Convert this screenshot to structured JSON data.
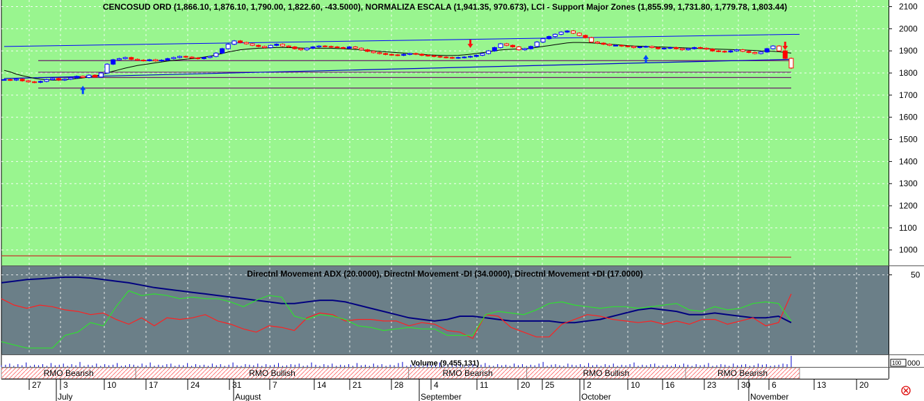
{
  "colors": {
    "price_bg": "#99f58f",
    "adx_bg": "#6b7f88",
    "bull_candle": "#0000ff",
    "bear_candle": "#ff0000",
    "adx_line": "#00007f",
    "minus_di_line": "#ff2020",
    "plus_di_line": "#30e030",
    "volume_bar": "#0000cc",
    "grid": "#ffffff",
    "rmo_hatch": "#ff6060"
  },
  "price_panel": {
    "title": "CENCOSUD ORD (1,866.10, 1,876.10, 1,790.00, 1,822.60, -43.5000), NORMALIZA ESCALA (1,941.35, 970.673), LCI - Support Major Zones (1,855.99, 1,731.80, 1,779.78, 1,803.44)",
    "y_ticks": [
      "2100",
      "2000",
      "1900",
      "1800",
      "1700",
      "1600",
      "1500",
      "1400",
      "1300",
      "1200",
      "1100",
      "1000"
    ]
  },
  "adx_panel": {
    "title": "Directnl Movement ADX (20.0000), Directnl Movement -DI (34.0000), Directnl Movement +DI (17.0000)",
    "y_ticks": [
      "50"
    ]
  },
  "volume_panel": {
    "title": "Volume (9,455,131)",
    "axis_box": "100",
    "axis_label": "000"
  },
  "rmo_bands": [
    {
      "label": "RMO Bearish",
      "start": 0,
      "end": 33
    },
    {
      "label": "RMO Bullish",
      "start": 33,
      "end": 100
    },
    {
      "label": "RMO Bearish",
      "start": 100,
      "end": 129
    },
    {
      "label": "RMO Bullish",
      "start": 129,
      "end": 168
    },
    {
      "label": "RMO Bearish",
      "start": 168,
      "end": 196
    }
  ],
  "x_axis": {
    "day_labels": [
      "27",
      "3",
      "10",
      "17",
      "24",
      "31",
      "7",
      "14",
      "21",
      "28",
      "4",
      "11",
      "20",
      "25",
      "2",
      "10",
      "16",
      "23",
      "30",
      "6",
      "13",
      "20"
    ],
    "month_labels": [
      "July",
      "August",
      "September",
      "October",
      "November"
    ]
  },
  "chart_data": [
    {
      "type": "candlestick",
      "title": "CENCOSUD ORD (1,866.10, 1,876.10, 1,790.00, 1,822.60, -43.5000), NORMALIZA ESCALA (1,941.35, 970.673), LCI - Support Major Zones (1,855.99, 1,731.80, 1,779.78, 1,803.44)",
      "ylim": [
        930,
        2130
      ],
      "last_bar": {
        "open": 1866.1,
        "high": 1876.1,
        "low": 1790.0,
        "close": 1822.6,
        "change": -43.5
      },
      "series": [
        {
          "kind": "close",
          "values": [
            1770,
            1768,
            1772,
            1765,
            1760,
            1758,
            1762,
            1770,
            1775,
            1768,
            1772,
            1778,
            1785,
            1780,
            1790,
            1782,
            1800,
            1840,
            1860,
            1865,
            1870,
            1862,
            1858,
            1856,
            1860,
            1855,
            1858,
            1865,
            1870,
            1875,
            1872,
            1868,
            1865,
            1870,
            1875,
            1890,
            1910,
            1930,
            1945,
            1938,
            1932,
            1925,
            1920,
            1915,
            1925,
            1930,
            1922,
            1918,
            1910,
            1905,
            1912,
            1918,
            1922,
            1920,
            1918,
            1915,
            1912,
            1918,
            1912,
            1905,
            1898,
            1892,
            1888,
            1884,
            1882,
            1880,
            1884,
            1888,
            1885,
            1880,
            1878,
            1875,
            1872,
            1870,
            1868,
            1870,
            1872,
            1875,
            1880,
            1888,
            1900,
            1915,
            1932,
            1925,
            1918,
            1905,
            1910,
            1920,
            1940,
            1955,
            1965,
            1975,
            1985,
            1990,
            1980,
            1970,
            1960,
            1940,
            1935,
            1930,
            1925,
            1925,
            1922,
            1920,
            1915,
            1918,
            1920,
            1915,
            1910,
            1912,
            1915,
            1910,
            1905,
            1910,
            1915,
            1912,
            1908,
            1900,
            1898,
            1895,
            1900,
            1905,
            1898,
            1893,
            1888,
            1895,
            1910,
            1922,
            1900,
            1866,
            1822.6
          ]
        },
        {
          "kind": "ma_black",
          "values": [
            1812,
            1805,
            1795,
            1788,
            1782,
            1776,
            1772,
            1770,
            1768,
            1768,
            1770,
            1772,
            1775,
            1778,
            1782,
            1786,
            1792,
            1800,
            1808,
            1815,
            1822,
            1828,
            1834,
            1838,
            1842,
            1846,
            1850,
            1854,
            1857,
            1860,
            1862,
            1865,
            1868,
            1872,
            1876,
            1882,
            1888,
            1895,
            1900,
            1905,
            1908,
            1910,
            1912,
            1913,
            1914,
            1915,
            1915,
            1915,
            1914,
            1913,
            1912,
            1912,
            1912,
            1912,
            1912,
            1911,
            1910,
            1908,
            1906,
            1904,
            1902,
            1900,
            1898,
            1896,
            1894,
            1892,
            1890,
            1888,
            1886,
            1884,
            1882,
            1881,
            1880,
            1879,
            1879,
            1880,
            1882,
            1885,
            1888,
            1892,
            1896,
            1900,
            1904,
            1906,
            1908,
            1909,
            1910,
            1912,
            1916,
            1920,
            1924,
            1928,
            1932,
            1936,
            1938,
            1938,
            1937,
            1936,
            1934,
            1932,
            1930,
            1928,
            1926,
            1924,
            1922,
            1921,
            1920,
            1919,
            1918,
            1917,
            1916,
            1915,
            1914,
            1913,
            1912,
            1911,
            1910,
            1909,
            1908,
            1907,
            1906,
            1905,
            1904,
            1903,
            1902,
            1900,
            1899,
            1898,
            1896,
            1893,
            1890
          ]
        },
        {
          "kind": "support_zone",
          "levels": [
            1855.99,
            1731.8,
            1779.78,
            1803.44
          ]
        },
        {
          "kind": "channel_top",
          "x": [
            0,
            195
          ],
          "values": [
            1920,
            1975
          ]
        },
        {
          "kind": "trend_line",
          "x": [
            0,
            130
          ],
          "values": [
            1775,
            1862
          ]
        },
        {
          "kind": "normaliza_escala",
          "value": 970.673
        }
      ],
      "signals": [
        {
          "x": 13,
          "dir": "up"
        },
        {
          "x": 77,
          "dir": "down"
        },
        {
          "x": 106,
          "dir": "up"
        },
        {
          "x": 129,
          "dir": "down"
        }
      ]
    },
    {
      "type": "line",
      "title": "Directnl Movement ADX (20.0000), Directnl Movement -DI (34.0000), Directnl Movement +DI (17.0000)",
      "ylim": [
        0,
        55
      ],
      "series": [
        {
          "name": "Directnl Movement ADX",
          "values": [
            45,
            46,
            47,
            47.5,
            48,
            48.5,
            48.5,
            48,
            47,
            46,
            45,
            43.5,
            42,
            41,
            40,
            39,
            38,
            37,
            36,
            35,
            34,
            33,
            32,
            32,
            33,
            34,
            34,
            33,
            31,
            29,
            27,
            25,
            23,
            22,
            21,
            22,
            24,
            24,
            23,
            22,
            21,
            21,
            21,
            21,
            20,
            20,
            21,
            22,
            24,
            26,
            28,
            29,
            28,
            27,
            25,
            25,
            26,
            25,
            24,
            23,
            23,
            24,
            20
          ]
        },
        {
          "name": "Directnl Movement -DI",
          "values": [
            35,
            31,
            29,
            31,
            30,
            28,
            27,
            25,
            26,
            22,
            19,
            23,
            18,
            23,
            22,
            23,
            25,
            21,
            19,
            16,
            14,
            18,
            17,
            15,
            23,
            26,
            25,
            21,
            22,
            22,
            21,
            21,
            18,
            20,
            19,
            15,
            14,
            10,
            25,
            24,
            17,
            14,
            11,
            11,
            19,
            22,
            25,
            24,
            22,
            21,
            20,
            21,
            19,
            21,
            19,
            22,
            22,
            19,
            21,
            23,
            18,
            20,
            38
          ]
        },
        {
          "name": "Directnl Movement +DI",
          "values": [
            8,
            6,
            4,
            4,
            4,
            12,
            14,
            20,
            18,
            30,
            40,
            37,
            38,
            37,
            35,
            36,
            35,
            35,
            33,
            30,
            34,
            37,
            36,
            24,
            22,
            25,
            24,
            22,
            18,
            17,
            15,
            16,
            17,
            16,
            16,
            12,
            12,
            12,
            25,
            27,
            26,
            25,
            28,
            32,
            33,
            31,
            30,
            29,
            30,
            30,
            29,
            30,
            31,
            32,
            28,
            27,
            30,
            28,
            29,
            32,
            33,
            32,
            21
          ]
        }
      ]
    },
    {
      "type": "bar",
      "title": "Volume (9,455,131)",
      "series": [
        {
          "name": "Volume",
          "values": [
            3,
            4,
            6,
            2,
            5,
            3,
            8,
            2,
            4,
            3,
            5,
            2,
            7,
            3,
            4,
            6,
            2,
            5,
            3,
            9,
            2,
            4,
            3,
            6,
            2,
            5,
            3,
            4,
            7,
            2,
            3,
            5,
            4,
            2,
            6,
            3,
            8,
            2,
            4,
            3,
            5,
            6,
            2,
            4,
            3,
            7,
            2,
            5,
            3,
            4,
            2,
            6,
            3,
            5,
            2,
            4,
            8,
            3,
            2,
            5,
            4,
            3,
            6,
            2,
            5,
            3,
            4,
            7,
            2,
            3,
            5,
            4,
            6,
            2,
            3,
            8,
            4,
            2,
            5,
            3,
            6,
            2,
            4,
            3,
            5,
            2,
            7,
            3,
            4,
            2,
            6,
            3,
            5,
            2,
            4,
            3,
            7,
            9,
            2,
            4,
            3,
            5,
            2,
            6,
            3,
            4,
            8,
            2,
            5,
            3,
            4,
            6,
            2,
            3,
            5,
            2,
            4,
            7,
            3,
            2,
            5,
            3,
            4,
            2,
            6,
            3,
            5,
            2,
            4,
            3,
            6,
            9,
            2,
            4,
            5,
            3,
            2,
            6,
            4,
            3,
            5,
            2,
            7,
            3,
            4,
            2,
            5,
            3,
            6,
            2,
            4,
            3,
            5,
            8,
            2,
            4,
            3,
            5,
            6,
            2,
            3,
            4,
            2,
            5,
            3,
            6,
            4,
            2,
            5,
            3,
            4,
            7,
            2,
            3,
            5,
            4,
            2,
            6,
            3,
            4,
            5,
            2,
            3,
            6,
            4,
            5,
            2,
            3,
            4,
            6,
            5,
            20
          ]
        }
      ]
    }
  ]
}
